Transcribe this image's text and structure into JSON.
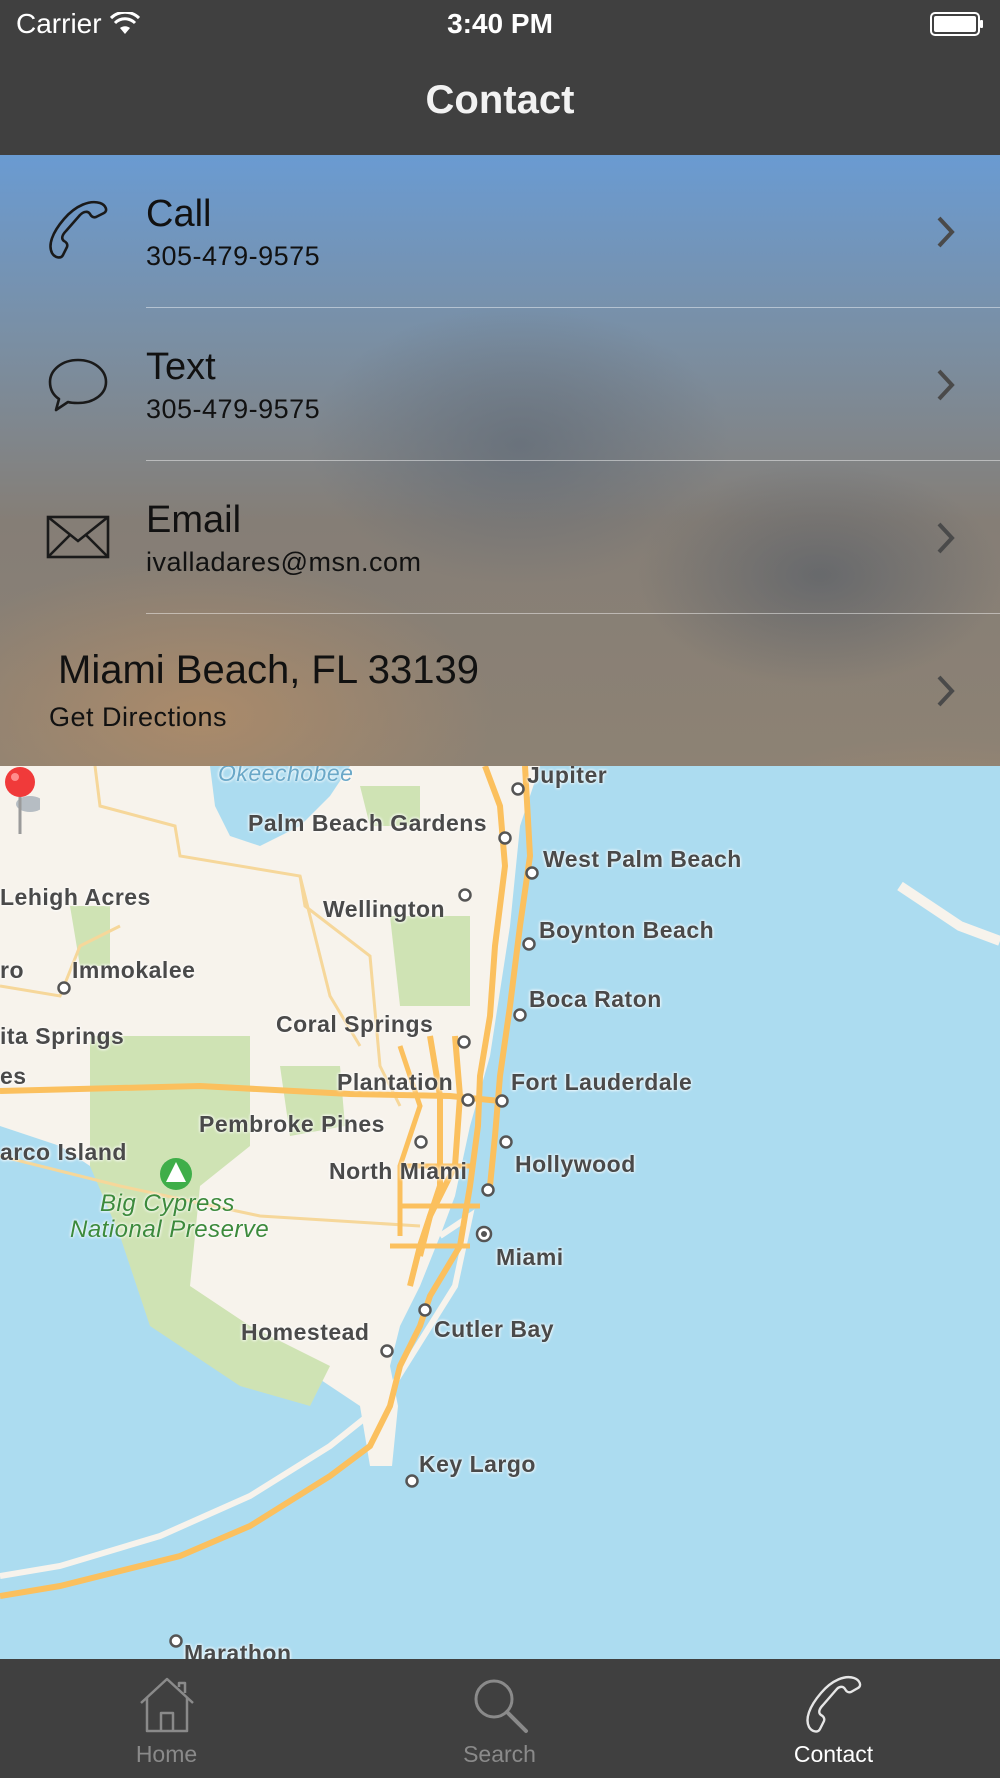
{
  "status_bar": {
    "carrier": "Carrier",
    "time": "3:40 PM"
  },
  "nav": {
    "title": "Contact"
  },
  "contact": {
    "call": {
      "label": "Call",
      "value": "305-479-9575",
      "icon": "phone-icon"
    },
    "text": {
      "label": "Text",
      "value": "305-479-9575",
      "icon": "speech-bubble-icon"
    },
    "email": {
      "label": "Email",
      "value": "ivalladares@msn.com",
      "icon": "envelope-icon"
    },
    "address": {
      "label": "Miami Beach, FL 33139",
      "action": "Get Directions"
    }
  },
  "map": {
    "labels": {
      "okeechobee": "Okeechobee",
      "jupiter": "Jupiter",
      "palm_beach_gardens": "Palm Beach Gardens",
      "west_palm_beach": "West Palm Beach",
      "lehigh_acres": "Lehigh Acres",
      "wellington": "Wellington",
      "boynton_beach": "Boynton Beach",
      "ro": "ro",
      "immokalee": "Immokalee",
      "boca_raton": "Boca Raton",
      "coral_springs": "Coral Springs",
      "ita_springs": "ita Springs",
      "es": "es",
      "plantation": "Plantation",
      "fort_lauderdale": "Fort Lauderdale",
      "pembroke_pines": "Pembroke Pines",
      "arco_island": "arco Island",
      "north_miami": "North Miami",
      "hollywood": "Hollywood",
      "big_cypress": "Big Cypress",
      "national_preserve": "National Preserve",
      "miami": "Miami",
      "homestead": "Homestead",
      "cutler_bay": "Cutler Bay",
      "key_largo": "Key Largo",
      "marathon": "Marathon"
    }
  },
  "tabs": [
    {
      "label": "Home",
      "icon": "house-icon",
      "active": false
    },
    {
      "label": "Search",
      "icon": "magnifier-icon",
      "active": false
    },
    {
      "label": "Contact",
      "icon": "phone-icon",
      "active": true
    }
  ],
  "colors": {
    "bar": "#404040",
    "water": "#acdcf0",
    "land": "#f7f3ec",
    "park": "#cfe3b4",
    "road": "#fbc05e",
    "pin": "#f03a3a"
  }
}
